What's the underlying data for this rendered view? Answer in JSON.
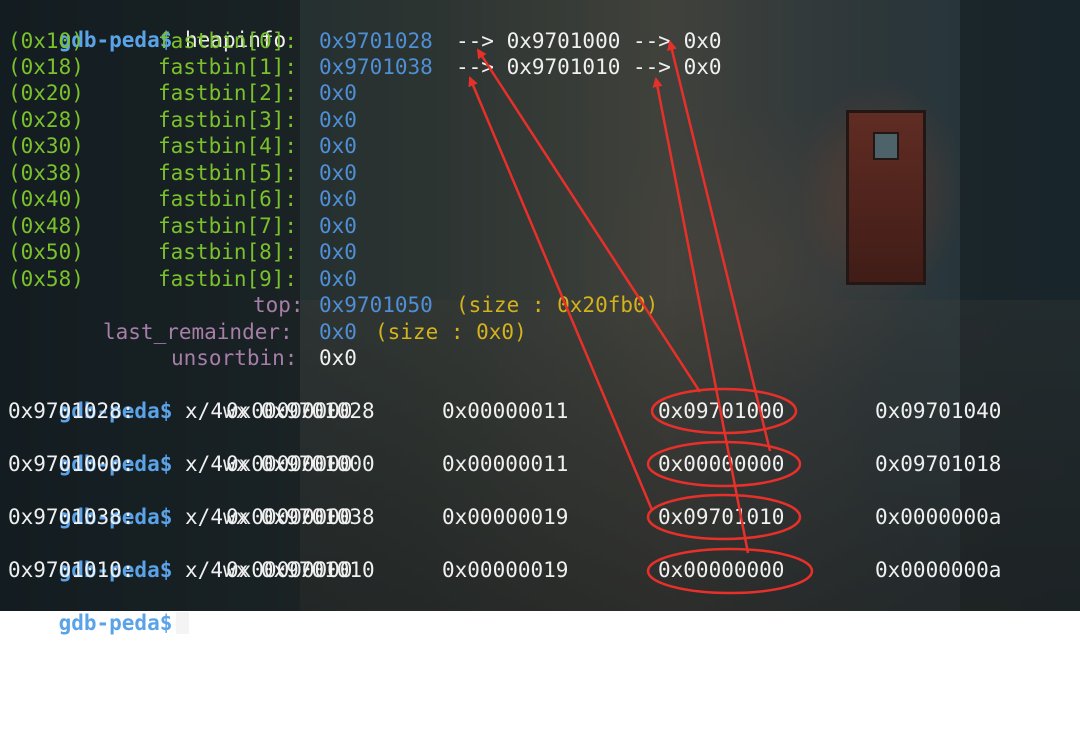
{
  "prompt": "gdb-peda$",
  "commands": {
    "heapinfo": "heapinfo",
    "x1": "x/4wx 0x9701028",
    "x2": "x/4wx 0x9701000",
    "x3": "x/4wx 0x9701038",
    "x4": "x/4wx 0x9701010"
  },
  "fastbins": [
    {
      "size": "(0x10)",
      "name": "fastbin[0]:",
      "addr": "0x9701028",
      "chain": "--> 0x9701000 --> 0x0"
    },
    {
      "size": "(0x18)",
      "name": "fastbin[1]:",
      "addr": "0x9701038",
      "chain": "--> 0x9701010 --> 0x0"
    },
    {
      "size": "(0x20)",
      "name": "fastbin[2]:",
      "addr": "0x0",
      "chain": ""
    },
    {
      "size": "(0x28)",
      "name": "fastbin[3]:",
      "addr": "0x0",
      "chain": ""
    },
    {
      "size": "(0x30)",
      "name": "fastbin[4]:",
      "addr": "0x0",
      "chain": ""
    },
    {
      "size": "(0x38)",
      "name": "fastbin[5]:",
      "addr": "0x0",
      "chain": ""
    },
    {
      "size": "(0x40)",
      "name": "fastbin[6]:",
      "addr": "0x0",
      "chain": ""
    },
    {
      "size": "(0x48)",
      "name": "fastbin[7]:",
      "addr": "0x0",
      "chain": ""
    },
    {
      "size": "(0x50)",
      "name": "fastbin[8]:",
      "addr": "0x0",
      "chain": ""
    },
    {
      "size": "(0x58)",
      "name": "fastbin[9]:",
      "addr": "0x0",
      "chain": ""
    }
  ],
  "top": {
    "label": "top:",
    "addr": "0x9701050",
    "size": "(size : 0x20fb0)"
  },
  "last_remainder": {
    "label": "last_remainder:",
    "addr": "0x0",
    "size": "(size : 0x0)"
  },
  "unsortbin": {
    "label": "unsortbin:",
    "addr": "0x0"
  },
  "dumps": [
    {
      "addr": "0x9701028:",
      "w": [
        "0x00000000",
        "0x00000011",
        "0x09701000",
        "0x09701040"
      ]
    },
    {
      "addr": "0x9701000:",
      "w": [
        "0x00000000",
        "0x00000011",
        "0x00000000",
        "0x09701018"
      ]
    },
    {
      "addr": "0x9701038:",
      "w": [
        "0x00000000",
        "0x00000019",
        "0x09701010",
        "0x0000000a"
      ]
    },
    {
      "addr": "0x9701010:",
      "w": [
        "0x00000000",
        "0x00000019",
        "0x00000000",
        "0x0000000a"
      ]
    }
  ],
  "colors": {
    "prompt": "#5ba3e8",
    "green": "#7ac22b",
    "blue": "#4f8fd6",
    "yellow": "#d4b21c",
    "annotation": "#e8302a"
  }
}
